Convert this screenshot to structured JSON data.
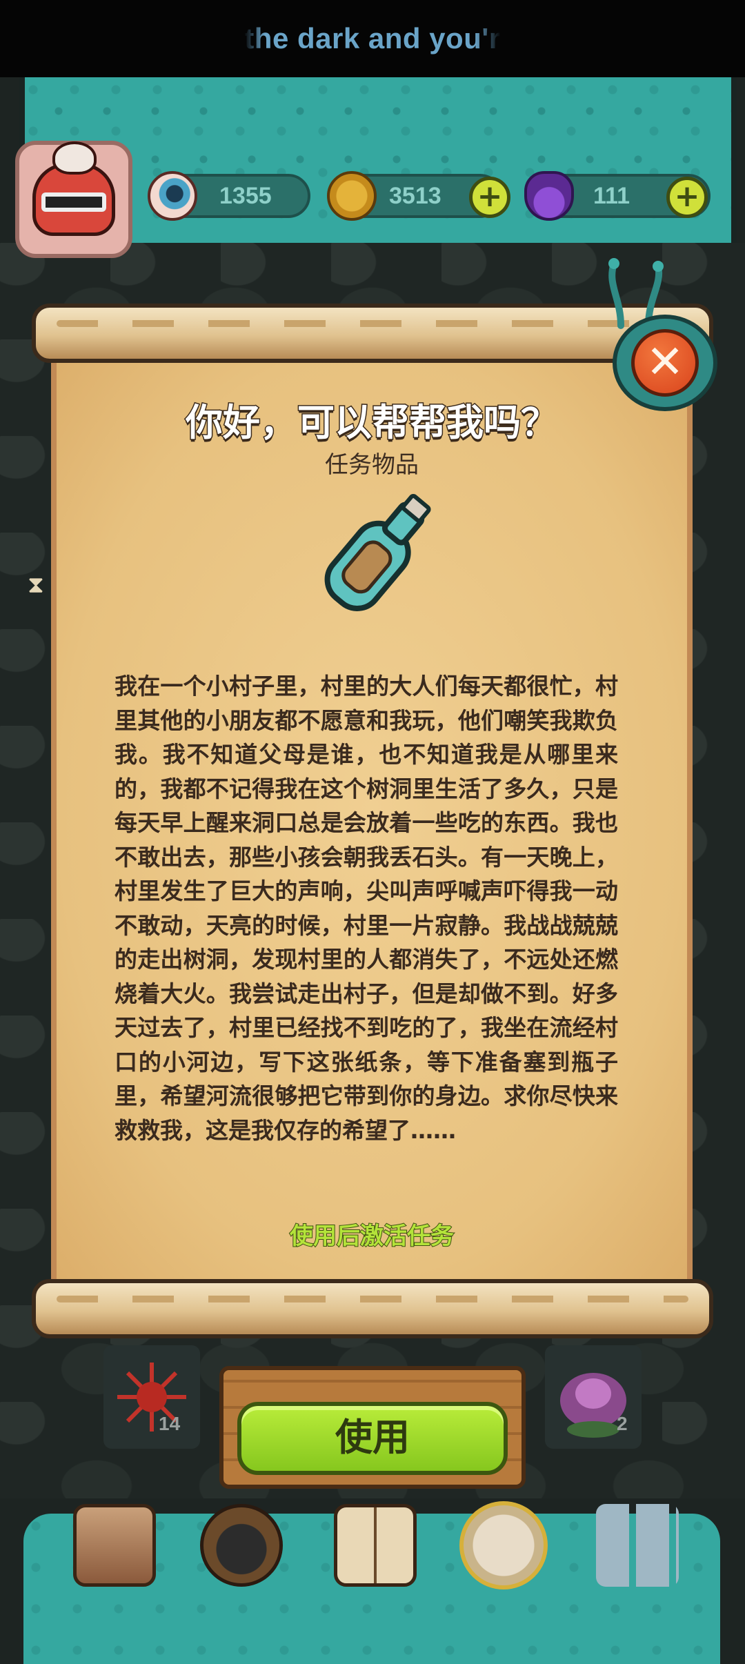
{
  "caption": {
    "text": "the dark and you'r"
  },
  "resources": {
    "eyes": {
      "value": "1355",
      "icon": "eyeball-icon"
    },
    "gold": {
      "value": "3513",
      "icon": "coin-icon"
    },
    "potion": {
      "value": "111",
      "icon": "potion-icon"
    }
  },
  "dialog": {
    "title": "你好，可以帮帮我吗？",
    "subtitle": "任务物品",
    "item_icon": "message-bottle-icon",
    "story": "我在一个小村子里，村里的大人们每天都很忙，村里其他的小朋友都不愿意和我玩，他们嘲笑我欺负我。我不知道父母是谁，也不知道我是从哪里来的，我都不记得我在这个树洞里生活了多久，只是每天早上醒来洞口总是会放着一些吃的东西。我也不敢出去，那些小孩会朝我丢石头。有一天晚上，村里发生了巨大的声响，尖叫声呼喊声吓得我一动不敢动，天亮的时候，村里一片寂静。我战战兢兢的走出树洞，发现村里的人都消失了，不远处还燃烧着大火。我尝试走出村子，但是却做不到。好多天过去了，村里已经找不到吃的了，我坐在流经村口的小河边，写下这张纸条，等下准备塞到瓶子里，希望河流很够把它带到你的身边。求你尽快来救救我，这是我仅存的希望了……",
    "activate_hint": "使用后激活任务",
    "close_symbol": "✕"
  },
  "inventory": {
    "slot_left_count": "14",
    "slot_right_count": "2"
  },
  "use_button": {
    "label": "使用"
  },
  "colors": {
    "accent_green": "#b4e33a",
    "teal": "#35a8a0",
    "parchment": "#e7c17f",
    "close_red": "#d9431c"
  }
}
